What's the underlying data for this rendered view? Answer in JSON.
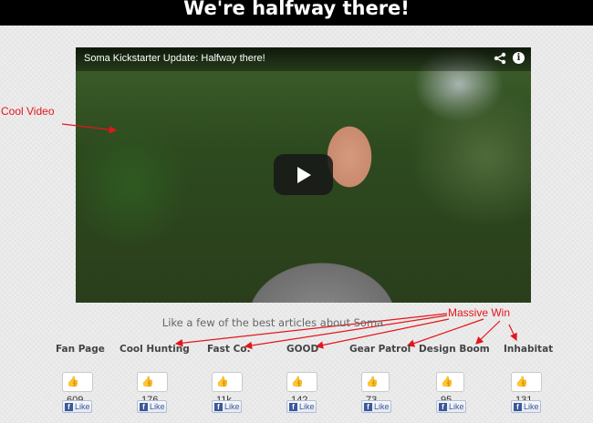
{
  "header": {
    "title": "We're halfway there!"
  },
  "video": {
    "title": "Soma Kickstarter Update: Halfway there!",
    "share_icon": "share-icon",
    "info_icon": "info-icon",
    "info_glyph": "i",
    "play_icon": "play-icon"
  },
  "annotations": {
    "cool_video": "Cool Video",
    "massive_win": "Massive Win",
    "color": "#e4161b"
  },
  "subtitle": "Like a few of the best articles about Soma",
  "articles": [
    {
      "name": "Fan Page",
      "count": "609",
      "like": "Like"
    },
    {
      "name": "Cool Hunting",
      "count": "176",
      "like": "Like"
    },
    {
      "name": "Fast Co.",
      "count": "11k",
      "like": "Like"
    },
    {
      "name": "GOOD",
      "count": "142",
      "like": "Like"
    },
    {
      "name": "Gear Patrol",
      "count": "73",
      "like": "Like"
    },
    {
      "name": "Design Boom",
      "count": "95",
      "like": "Like"
    },
    {
      "name": "Inhabitat",
      "count": "131",
      "like": "Like"
    }
  ],
  "colors": {
    "facebook": "#3b5998",
    "header_bg": "#000000"
  }
}
